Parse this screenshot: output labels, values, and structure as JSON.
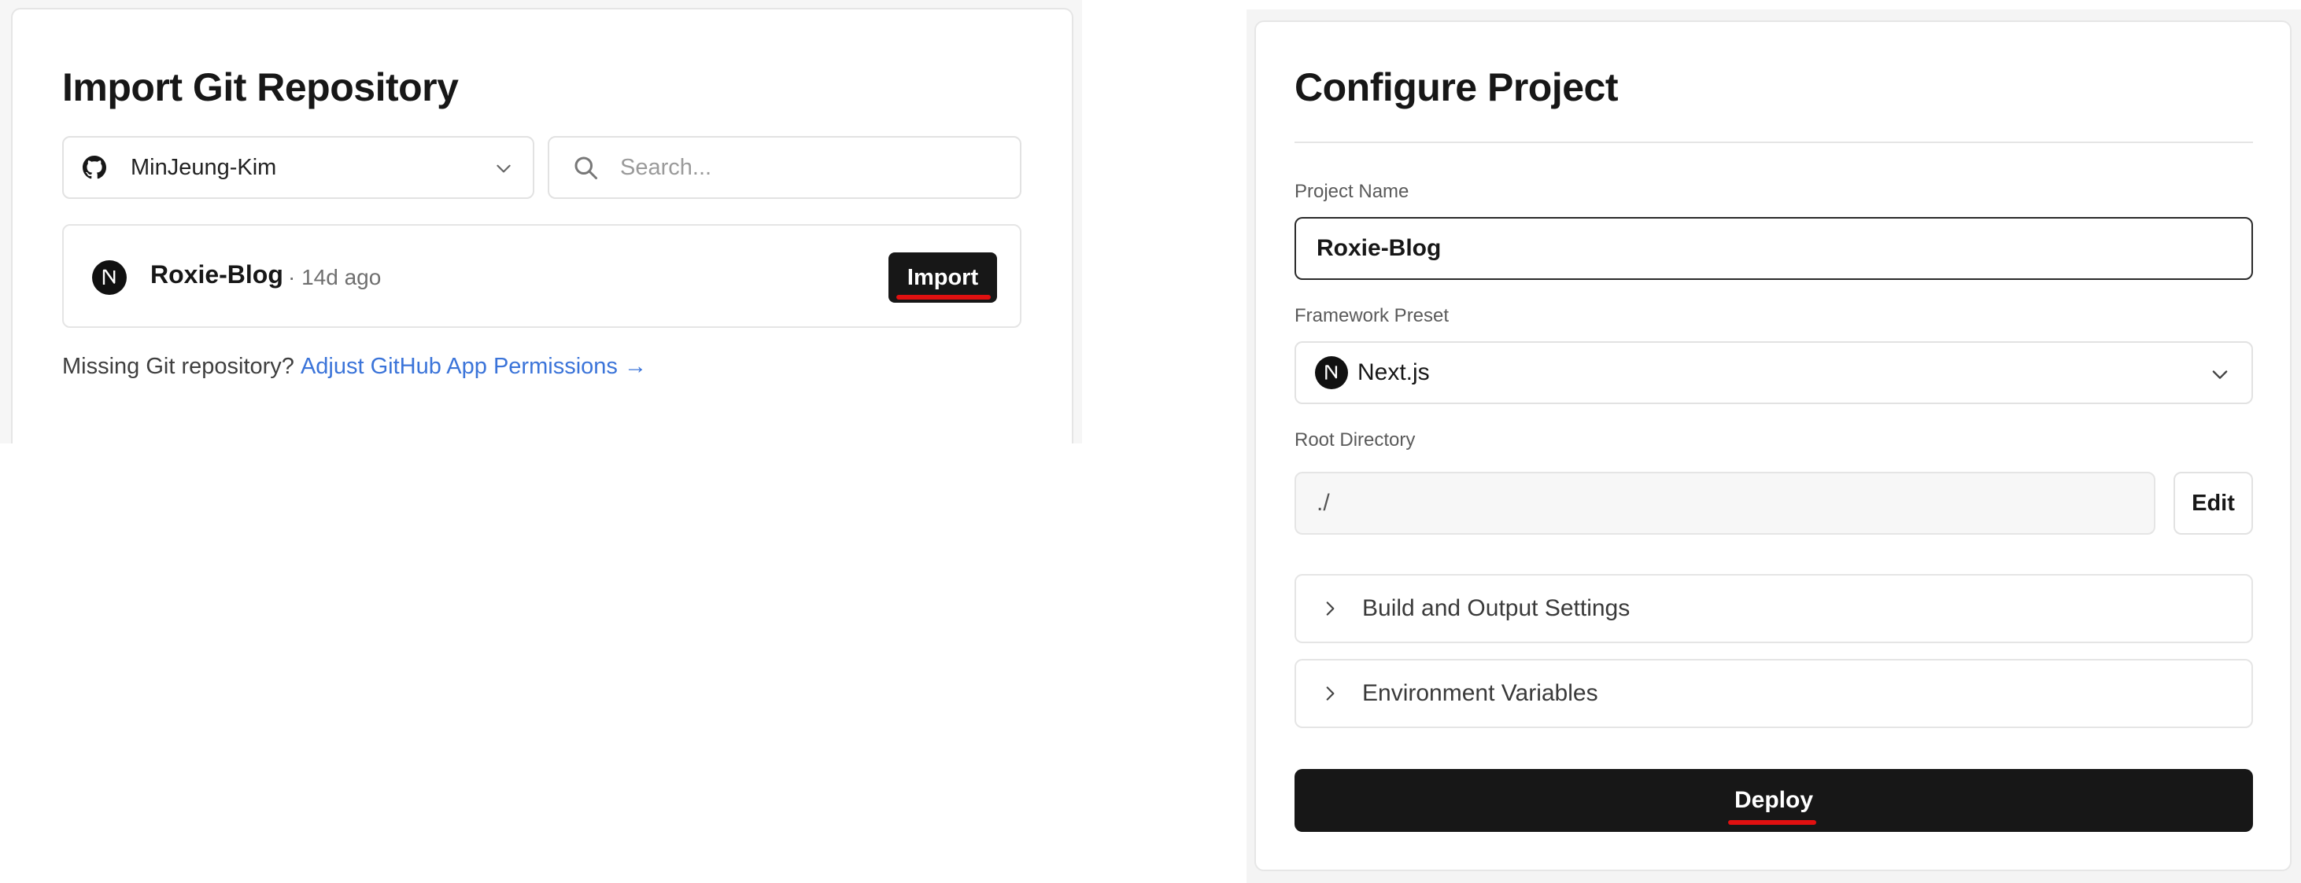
{
  "import_panel": {
    "title": "Import Git Repository",
    "account": {
      "name": "MinJeung-Kim",
      "icon": "github-icon"
    },
    "search": {
      "placeholder": "Search...",
      "value": ""
    },
    "repository": {
      "name": "Roxie-Blog",
      "updated": "· 14d ago",
      "icon": "nextjs-logo-icon",
      "import_label": "Import"
    },
    "missing": {
      "text": "Missing Git repository?",
      "link": "Adjust GitHub App Permissions →"
    }
  },
  "configure_panel": {
    "title": "Configure Project",
    "project_name": {
      "label": "Project Name",
      "value": "Roxie-Blog"
    },
    "framework": {
      "label": "Framework Preset",
      "value": "Next.js",
      "icon": "nextjs-logo-icon"
    },
    "root_directory": {
      "label": "Root Directory",
      "value": "./",
      "edit_label": "Edit"
    },
    "sections": [
      {
        "label": "Build and Output Settings"
      },
      {
        "label": "Environment Variables"
      }
    ],
    "deploy_label": "Deploy"
  },
  "colors": {
    "accent_dark": "#171717",
    "link": "#3b74d9",
    "highlight_underline": "#e01010"
  }
}
